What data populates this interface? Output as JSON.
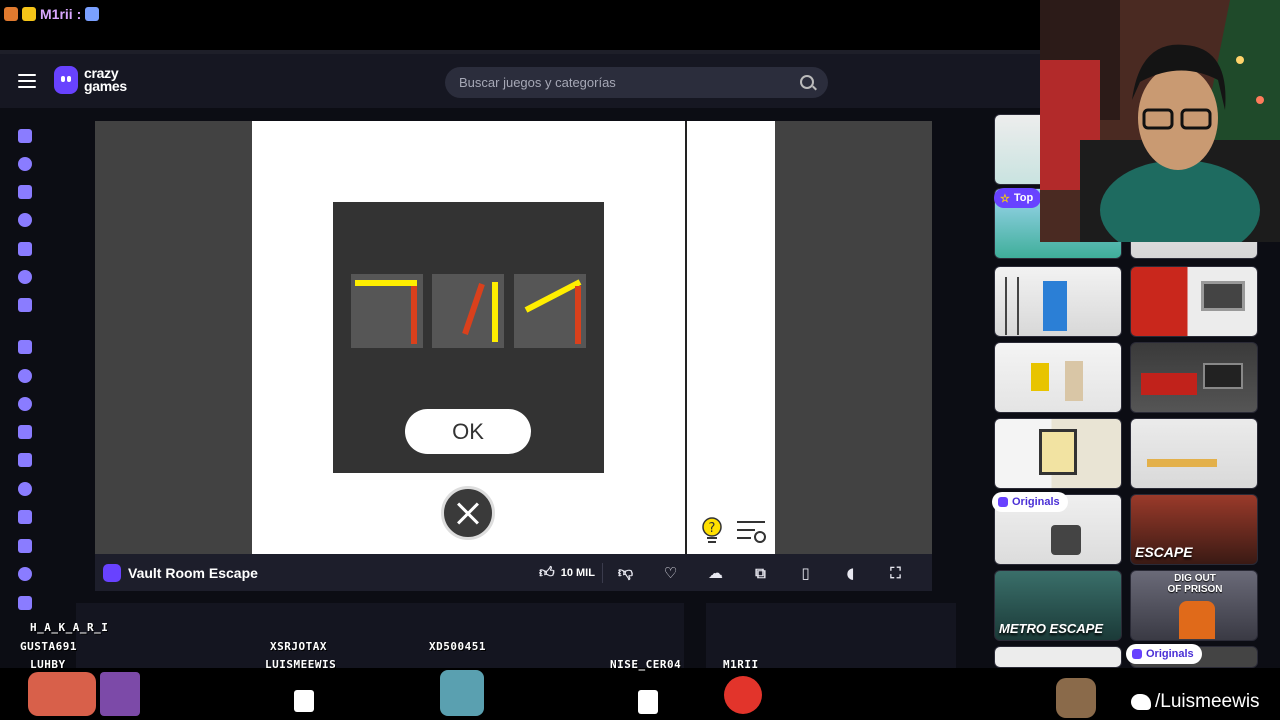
{
  "stream": {
    "chat_user": "M1rii :",
    "twitter_handle": "/Luismeewis",
    "viewers": [
      "H_A_K_A_R_I",
      "GUSTA691",
      "LUHBY",
      "XSRJOTAX",
      "LUISMEEWIS",
      "XD500451",
      "NISE_CER04",
      "M1RII"
    ]
  },
  "header": {
    "logo_line1": "crazy",
    "logo_line2": "games",
    "search_placeholder": "Buscar juegos y categorías"
  },
  "game": {
    "title": "Vault Room Escape",
    "ok_label": "OK",
    "likes": "10 MIL"
  },
  "thumbs": {
    "top_tag": "Top",
    "originals_tag": "Originals",
    "escape_label": "ESCAPE",
    "metro_label": "METRO ESCAPE",
    "prison_line1": "DIG OUT",
    "prison_line2": "OF PRISON"
  },
  "colors": {
    "brand": "#6842ff",
    "yellow_bar": "#ffee00",
    "red_bar": "#d9401c"
  }
}
